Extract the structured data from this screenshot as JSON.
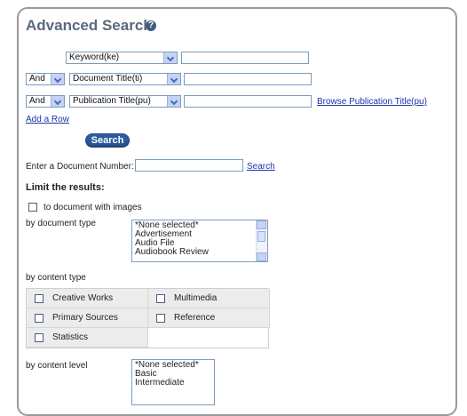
{
  "header": {
    "title": "Advanced Search",
    "help_glyph": "?"
  },
  "rows": [
    {
      "operator": null,
      "field": "Keyword(ke)",
      "value": ""
    },
    {
      "operator": "And",
      "field": "Document Title(ti)",
      "value": ""
    },
    {
      "operator": "And",
      "field": "Publication Title(pu)",
      "value": "",
      "browse_link": "Browse   Publication Title(pu)"
    }
  ],
  "add_row_link": "Add a Row",
  "search_button": "Search",
  "doc_number": {
    "label": "Enter a Document Number:",
    "value": "",
    "search_link": "Search"
  },
  "limit": {
    "heading": "Limit the results:",
    "images_checkbox": {
      "label": "to document with images",
      "checked": false
    }
  },
  "doc_type": {
    "label": "by document type",
    "options": [
      "*None selected*",
      "Advertisement",
      "Audio File",
      "Audiobook Review"
    ]
  },
  "content_type": {
    "label": "by content type",
    "options": [
      {
        "label": "Creative Works",
        "checked": false
      },
      {
        "label": "Multimedia",
        "checked": false
      },
      {
        "label": "Primary Sources",
        "checked": false
      },
      {
        "label": "Reference",
        "checked": false
      },
      {
        "label": "Statistics",
        "checked": false
      }
    ]
  },
  "content_level": {
    "label": "by content level",
    "options": [
      "*None selected*",
      "Basic",
      "Intermediate"
    ]
  }
}
